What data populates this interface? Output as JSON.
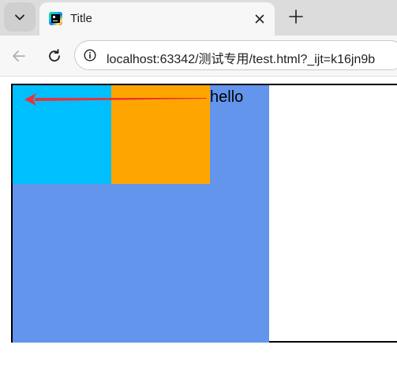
{
  "browser": {
    "tab": {
      "title": "Title",
      "favicon": "jetbrains-icon"
    },
    "url": "localhost:63342/测试专用/test.html?_ijt=k16jn9b",
    "icons": {
      "tab_list": "chevron-down-icon",
      "close": "close-icon",
      "new_tab": "plus-icon",
      "back": "arrow-left-icon",
      "reload": "reload-icon",
      "site_info": "info-icon"
    }
  },
  "page": {
    "text": "hello",
    "colors": {
      "blue_area": "#6495ed",
      "cyan_box": "#00bfff",
      "orange_box": "#ffa500",
      "border": "#000000",
      "annotation_arrow": "#e8333a"
    }
  }
}
